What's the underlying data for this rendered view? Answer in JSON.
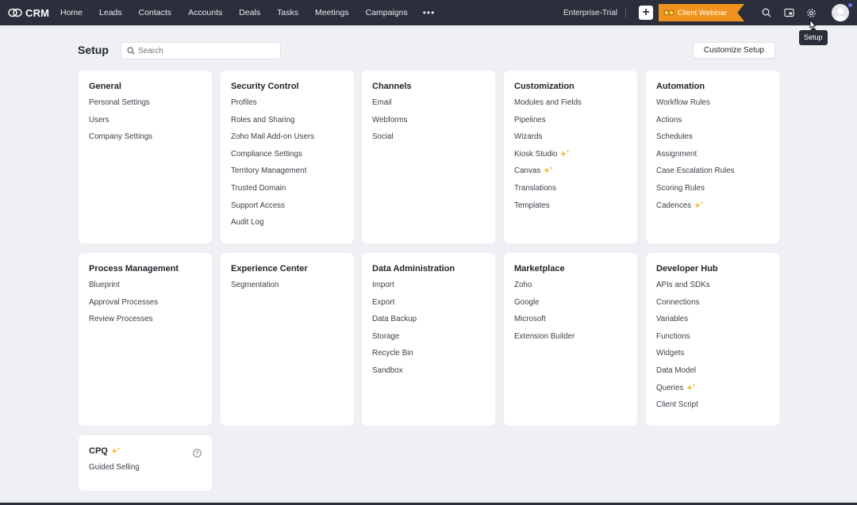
{
  "app": {
    "name": "CRM"
  },
  "nav": {
    "items": [
      "Home",
      "Leads",
      "Contacts",
      "Accounts",
      "Deals",
      "Tasks",
      "Meetings",
      "Campaigns"
    ],
    "more": "•••"
  },
  "topright": {
    "edition": "Enterprise-Trial",
    "webinar": "Client Webinar",
    "tooltip": "Setup"
  },
  "page": {
    "title": "Setup",
    "search_placeholder": "Search",
    "customize_label": "Customize Setup"
  },
  "colors": {
    "topbar": "#2b2f3b",
    "accent": "#f0921e",
    "sparkle": "#f2b82b"
  },
  "cards": [
    {
      "title": "General",
      "items": [
        {
          "label": "Personal Settings"
        },
        {
          "label": "Users"
        },
        {
          "label": "Company Settings"
        }
      ]
    },
    {
      "title": "Security Control",
      "items": [
        {
          "label": "Profiles"
        },
        {
          "label": "Roles and Sharing"
        },
        {
          "label": "Zoho Mail Add-on Users"
        },
        {
          "label": "Compliance Settings"
        },
        {
          "label": "Territory Management"
        },
        {
          "label": "Trusted Domain"
        },
        {
          "label": "Support Access"
        },
        {
          "label": "Audit Log"
        }
      ]
    },
    {
      "title": "Channels",
      "items": [
        {
          "label": "Email"
        },
        {
          "label": "Webforms"
        },
        {
          "label": "Social"
        }
      ]
    },
    {
      "title": "Customization",
      "items": [
        {
          "label": "Modules and Fields"
        },
        {
          "label": "Pipelines"
        },
        {
          "label": "Wizards"
        },
        {
          "label": "Kiosk Studio",
          "sparkle": true
        },
        {
          "label": "Canvas",
          "sparkle": true
        },
        {
          "label": "Translations"
        },
        {
          "label": "Templates"
        }
      ]
    },
    {
      "title": "Automation",
      "items": [
        {
          "label": "Workflow Rules"
        },
        {
          "label": "Actions"
        },
        {
          "label": "Schedules"
        },
        {
          "label": "Assignment"
        },
        {
          "label": "Case Escalation Rules"
        },
        {
          "label": "Scoring Rules"
        },
        {
          "label": "Cadences",
          "sparkle": true
        }
      ]
    },
    {
      "title": "Process Management",
      "items": [
        {
          "label": "Blueprint"
        },
        {
          "label": "Approval Processes"
        },
        {
          "label": "Review Processes"
        }
      ]
    },
    {
      "title": "Experience Center",
      "items": [
        {
          "label": "Segmentation"
        }
      ]
    },
    {
      "title": "Data Administration",
      "items": [
        {
          "label": "Import"
        },
        {
          "label": "Export"
        },
        {
          "label": "Data Backup"
        },
        {
          "label": "Storage"
        },
        {
          "label": "Recycle Bin"
        },
        {
          "label": "Sandbox"
        }
      ]
    },
    {
      "title": "Marketplace",
      "items": [
        {
          "label": "Zoho"
        },
        {
          "label": "Google"
        },
        {
          "label": "Microsoft"
        },
        {
          "label": "Extension Builder"
        }
      ]
    },
    {
      "title": "Developer Hub",
      "items": [
        {
          "label": "APIs and SDKs"
        },
        {
          "label": "Connections"
        },
        {
          "label": "Variables"
        },
        {
          "label": "Functions"
        },
        {
          "label": "Widgets"
        },
        {
          "label": "Data Model"
        },
        {
          "label": "Queries",
          "sparkle": true
        },
        {
          "label": "Client Script"
        }
      ]
    },
    {
      "title": "CPQ",
      "title_sparkle": true,
      "help": true,
      "items": [
        {
          "label": "Guided Selling"
        }
      ]
    }
  ]
}
